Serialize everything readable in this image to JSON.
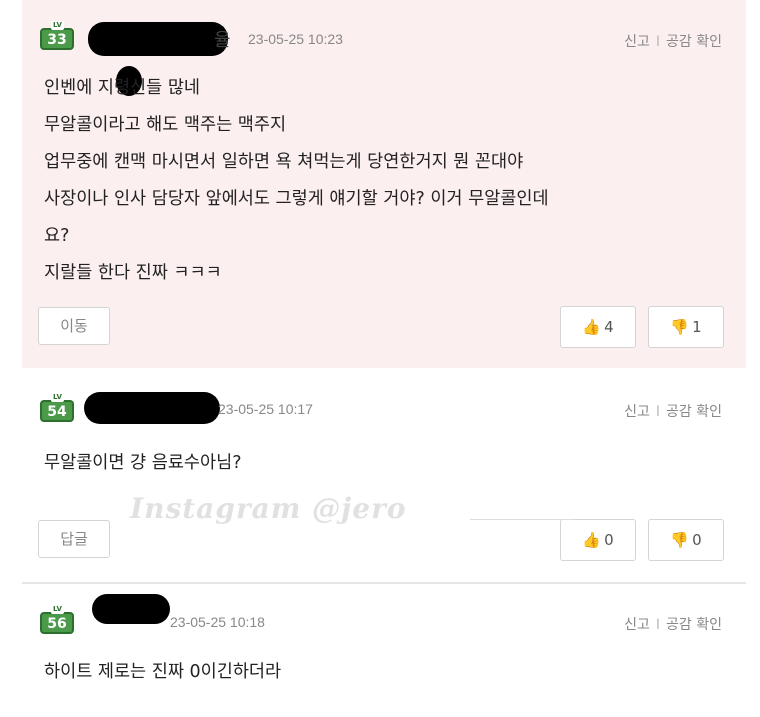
{
  "comments": [
    {
      "level": "33",
      "name_tail": "율",
      "date": "23-05-25 10:23",
      "action_report": "신고",
      "action_like": "공감 확인",
      "lines": [
        "인벤에 지령신들 많네",
        "무알콜이라고 해도 맥주는 맥주지",
        "업무중에 캔맥 마시면서 일하면 욕 쳐먹는게 당연한거지 뭔 꼰대야",
        "사장이나 인사 담당자 앞에서도 그렇게 얘기할 거야? 이거 무알콜인데",
        "요?",
        "지랄들 한다 진짜 ㅋㅋㅋ"
      ],
      "left_button": "이동",
      "up_icon": "👍",
      "up_count": "4",
      "down_icon": "👎",
      "down_count": "1"
    },
    {
      "level": "54",
      "date": "23-05-25 10:17",
      "action_report": "신고",
      "action_like": "공감 확인",
      "lines": [
        "무알콜이면 걍 음료수아님?"
      ],
      "left_button": "답글",
      "up_icon": "👍",
      "up_count": "0",
      "down_icon": "👎",
      "down_count": "0"
    },
    {
      "level": "56",
      "date": "23-05-25 10:18",
      "action_report": "신고",
      "action_like": "공감 확인",
      "lines": [
        "하이트 제로는 진짜 0이긴하더라"
      ]
    }
  ],
  "separator": "I",
  "watermark": "Instagram @jero"
}
